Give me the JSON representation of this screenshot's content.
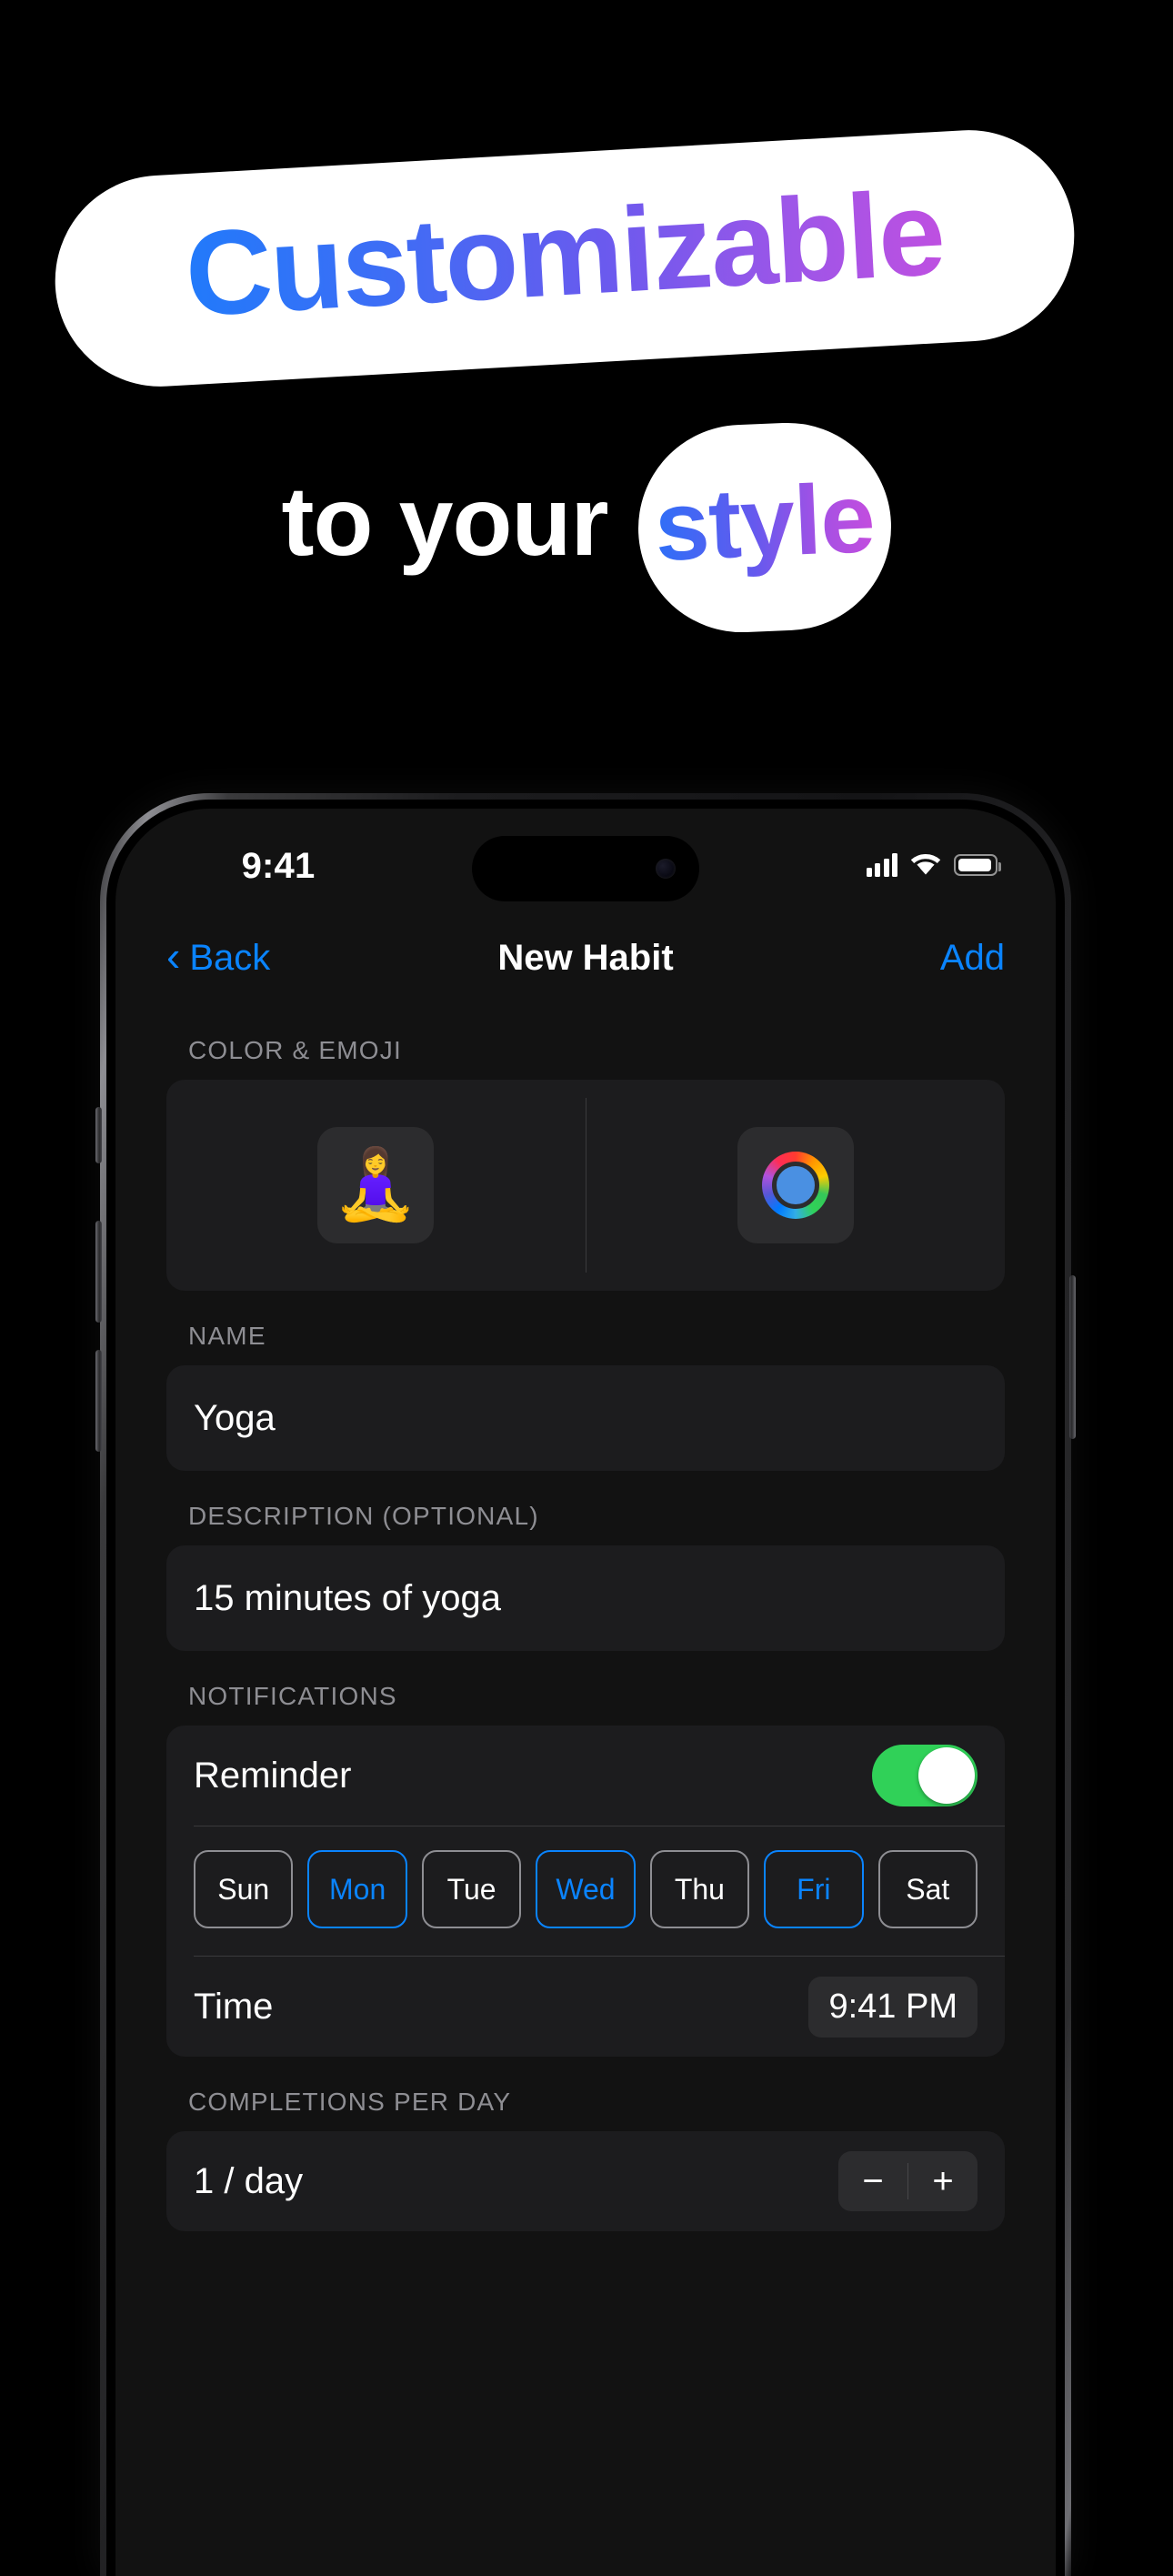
{
  "hero": {
    "headline_pill": "Customizable",
    "line2_prefix": "to your",
    "line2_pill": "style",
    "gradient_start": "#1F7BFB",
    "gradient_end": "#C24FE0",
    "background": "#000000"
  },
  "phone": {
    "status_bar": {
      "time": "9:41",
      "cellular_icon": "cellular-bars-icon",
      "wifi_icon": "wifi-icon",
      "battery_icon": "battery-full-icon"
    },
    "nav_bar": {
      "back_label": "Back",
      "back_icon": "chevron-left-icon",
      "title": "New Habit",
      "add_label": "Add",
      "accent_color": "#0A84FF"
    },
    "sections": {
      "color_emoji": {
        "label": "COLOR & EMOJI",
        "emoji": "🧘‍♀️",
        "emoji_name": "woman-in-lotus-position-emoji",
        "color_picker_name": "color-wheel-icon",
        "selected_color": "#4A90E2"
      },
      "name": {
        "label": "NAME",
        "value": "Yoga",
        "placeholder": "Name"
      },
      "description": {
        "label": "DESCRIPTION (OPTIONAL)",
        "value": "15 minutes of yoga",
        "placeholder": "Description"
      },
      "notifications": {
        "label": "NOTIFICATIONS",
        "reminder_label": "Reminder",
        "reminder_on": true,
        "days": [
          {
            "label": "Sun",
            "selected": false
          },
          {
            "label": "Mon",
            "selected": true
          },
          {
            "label": "Tue",
            "selected": false
          },
          {
            "label": "Wed",
            "selected": true
          },
          {
            "label": "Thu",
            "selected": false
          },
          {
            "label": "Fri",
            "selected": true
          },
          {
            "label": "Sat",
            "selected": false
          }
        ],
        "time_label": "Time",
        "time_value": "9:41 PM"
      },
      "completions": {
        "label": "COMPLETIONS PER DAY",
        "value": "1 / day",
        "minus_label": "−",
        "plus_label": "+"
      }
    }
  }
}
